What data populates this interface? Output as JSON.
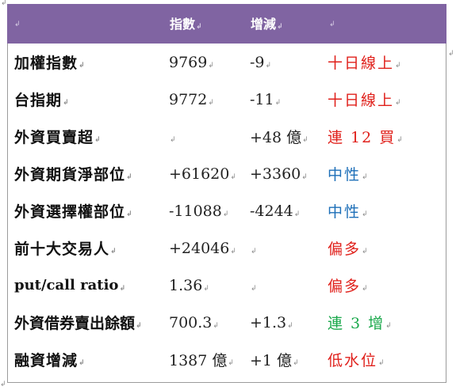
{
  "table": {
    "header": {
      "index_label": "指數",
      "change_label": "增減"
    },
    "rows": [
      {
        "name": "加權指數",
        "index": "9769",
        "change": "-9",
        "status": "十日線上",
        "status_color": "#e0201b"
      },
      {
        "name": "台指期",
        "index": "9772",
        "change": "-11",
        "status": "十日線上",
        "status_color": "#e0201b"
      },
      {
        "name": "外資買賣超",
        "index": "",
        "change": "+48 億",
        "status": "連 12 買",
        "status_color": "#e0201b"
      },
      {
        "name": "外資期貨淨部位",
        "index": "+61620",
        "change": "+3360",
        "status": "中性",
        "status_color": "#1d6fb8"
      },
      {
        "name": "外資選擇權部位",
        "index": "-11088",
        "change": "-4244",
        "status": "中性",
        "status_color": "#1d6fb8"
      },
      {
        "name": "前十大交易人",
        "index": "+24046",
        "change": "",
        "status": "偏多",
        "status_color": "#e0201b"
      },
      {
        "name": "put/call ratio",
        "index": "1.36",
        "change": "",
        "status": "偏多",
        "status_color": "#e0201b"
      },
      {
        "name": "外資借券賣出餘額",
        "index": "700.3",
        "change": "+1.3",
        "status": "連 3 增",
        "status_color": "#1aa84b"
      },
      {
        "name": "融資增減",
        "index": "1387 億",
        "change": "+1 億",
        "status": "低水位",
        "status_color": "#e0201b"
      }
    ]
  },
  "colors": {
    "header_bg": "#8064a2",
    "border": "#9b9b9b"
  }
}
